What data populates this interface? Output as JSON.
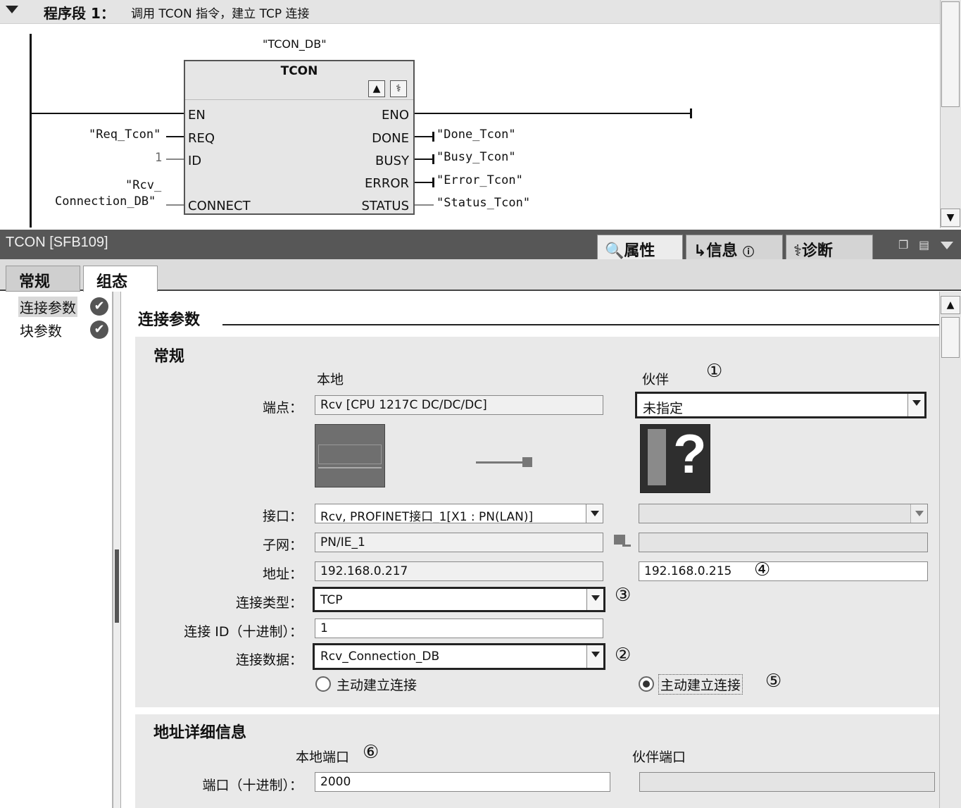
{
  "network": {
    "title": "程序段 1：",
    "description": "调用 TCON 指令，建立 TCP 连接",
    "block": {
      "instance_db": "\"TCON_DB\"",
      "name": "TCON",
      "pins_left": [
        "EN",
        "REQ",
        "ID",
        "CONNECT"
      ],
      "pins_right": [
        "ENO",
        "DONE",
        "BUSY",
        "ERROR",
        "STATUS"
      ]
    },
    "inputs": {
      "req": "\"Req_Tcon\"",
      "id": "1",
      "connect_line1": "\"Rcv_",
      "connect_line2": "Connection_DB\""
    },
    "outputs": {
      "done": "\"Done_Tcon\"",
      "busy": "\"Busy_Tcon\"",
      "error": "\"Error_Tcon\"",
      "status": "\"Status_Tcon\""
    }
  },
  "panel": {
    "title": "TCON [SFB109]",
    "tabs": [
      "属性",
      "信息",
      "诊断"
    ],
    "active_tab": "属性",
    "subtabs": [
      "常规",
      "组态"
    ],
    "active_subtab": "组态",
    "nav": [
      {
        "label": "连接参数",
        "status": "ok"
      },
      {
        "label": "块参数",
        "status": "ok"
      }
    ]
  },
  "connection": {
    "section_title": "连接参数",
    "general_title": "常规",
    "local_heading": "本地",
    "partner_heading": "伙伴",
    "labels": {
      "endpoint": "端点：",
      "interface": "接口：",
      "subnet": "子网：",
      "address": "地址：",
      "conn_type": "连接类型：",
      "conn_id": "连接 ID（十进制）：",
      "conn_data": "连接数据："
    },
    "local": {
      "endpoint": "Rcv [CPU 1217C DC/DC/DC]",
      "interface": "Rcv, PROFINET接口_1[X1 : PN(LAN)]",
      "subnet": "PN/IE_1",
      "address": "192.168.0.217"
    },
    "partner": {
      "endpoint": "未指定",
      "interface": "",
      "subnet": "",
      "address": "192.168.0.215"
    },
    "conn_type": "TCP",
    "conn_id": "1",
    "conn_data": "Rcv_Connection_DB",
    "active_local_label": "主动建立连接",
    "active_partner_label": "主动建立连接",
    "active_side": "partner"
  },
  "address_details": {
    "title": "地址详细信息",
    "local_port_heading": "本地端口",
    "partner_port_heading": "伙伴端口",
    "port_label": "端口（十进制）：",
    "local_port": "2000",
    "partner_port": ""
  },
  "callouts": [
    "①",
    "②",
    "③",
    "④",
    "⑤",
    "⑥"
  ]
}
